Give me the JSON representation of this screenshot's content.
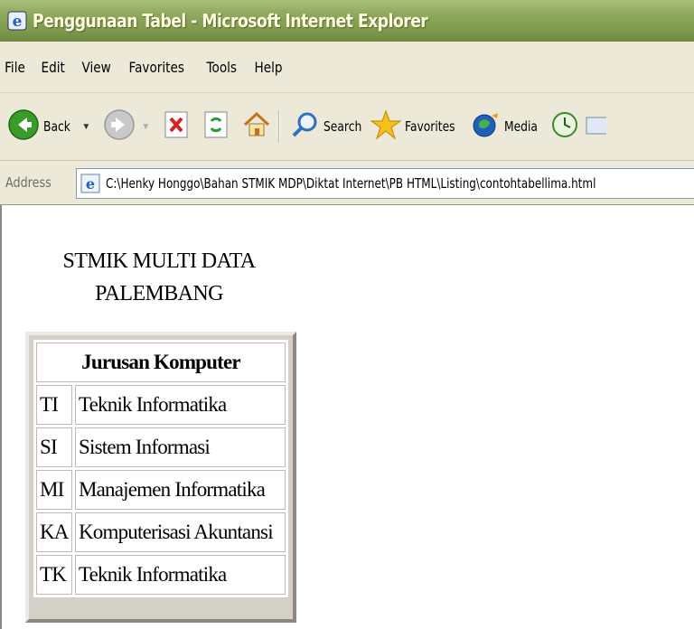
{
  "window": {
    "title": "Penggunaan Tabel - Microsoft Internet Explorer",
    "app_icon": "ie-icon"
  },
  "menu": [
    "File",
    "Edit",
    "View",
    "Favorites",
    "Tools",
    "Help"
  ],
  "toolbar": {
    "back_label": "Back",
    "search_label": "Search",
    "favorites_label": "Favorites",
    "media_label": "Media"
  },
  "address": {
    "label": "Address",
    "url": "C:\\Henky Honggo\\Bahan STMIK MDP\\Diktat Internet\\PB HTML\\Listing\\contohtabellima.html"
  },
  "page": {
    "heading_line1": "STMIK MULTI DATA",
    "heading_line2": "PALEMBANG",
    "table": {
      "header": "Jurusan Komputer",
      "rows": [
        {
          "code": "TI",
          "name": "Teknik Informatika"
        },
        {
          "code": "SI",
          "name": "Sistem Informasi"
        },
        {
          "code": "MI",
          "name": "Manajemen Informatika"
        },
        {
          "code": "KA",
          "name": "Komputerisasi Akuntansi"
        },
        {
          "code": "TK",
          "name": "Teknik Informatika"
        }
      ]
    }
  },
  "colors": {
    "titlebar": "#8ea85c",
    "chrome": "#ece9d8",
    "back_green": "#3a9a2a"
  }
}
